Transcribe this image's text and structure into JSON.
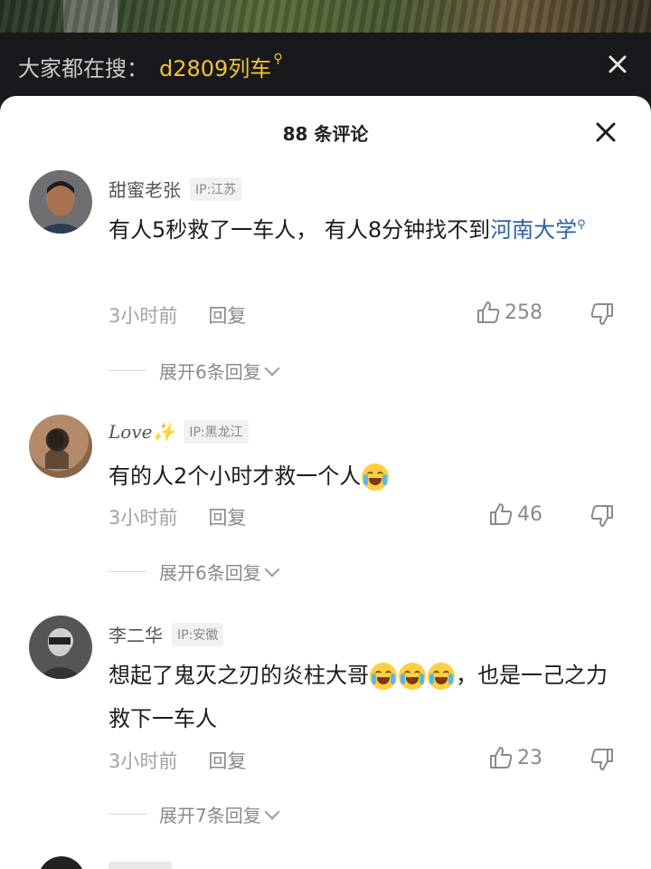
{
  "search_bar": {
    "label": "大家都在搜：",
    "keyword": "d2809列车"
  },
  "comments_sheet": {
    "title": "88 条评论"
  },
  "comments": [
    {
      "username": "甜蜜老张",
      "ip": "IP:江苏",
      "text_before": "有人5秒救了一车人， 有人8分钟找不到",
      "link_text": "河南大学",
      "time": "3小时前",
      "reply_label": "回复",
      "likes": "258",
      "expand_label": "展开6条回复"
    },
    {
      "username": "Love✨",
      "ip": "IP:黑龙江",
      "text": "有的人2个小时才救一个人",
      "time": "3小时前",
      "reply_label": "回复",
      "likes": "46",
      "expand_label": "展开6条回复"
    },
    {
      "username": "李二华",
      "ip": "IP:安徽",
      "text_before": "想起了鬼灭之刃的炎柱大哥",
      "text_after": "，也是一己之力救下一车人",
      "time": "3小时前",
      "reply_label": "回复",
      "likes": "23",
      "expand_label": "展开7条回复"
    }
  ],
  "colors": {
    "keyword": "#f2c23a",
    "link": "#2f5fa7",
    "muted": "#a3a3a3"
  }
}
